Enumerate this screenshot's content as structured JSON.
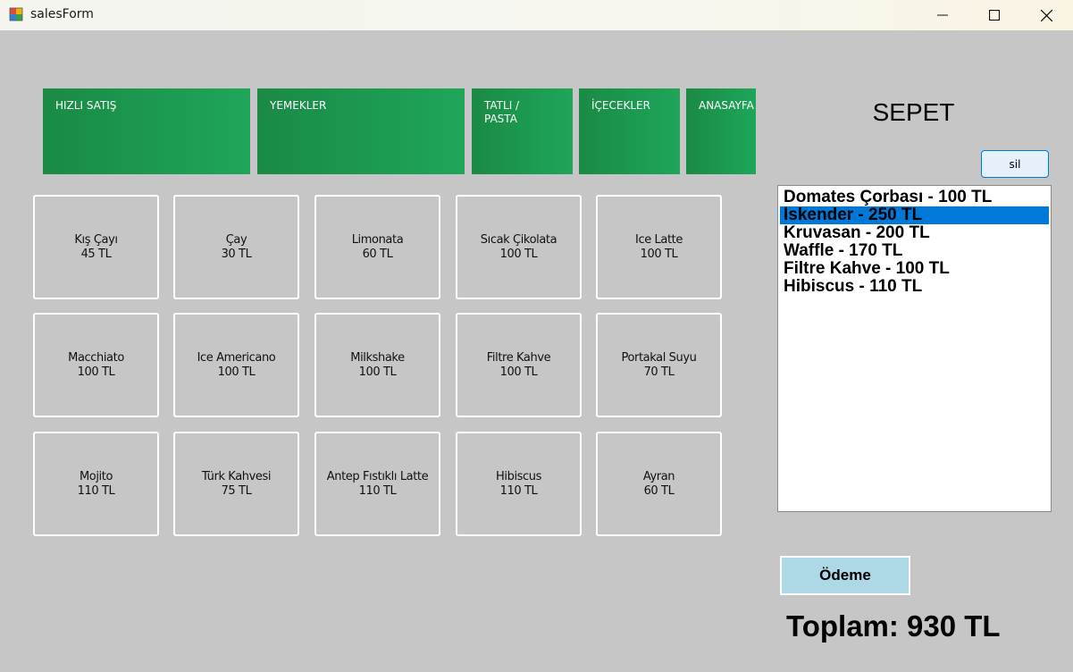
{
  "window": {
    "title": "salesForm",
    "app_icon": "windows-forms-icon",
    "controls": [
      "minimize-icon",
      "maximize-icon",
      "close-icon"
    ]
  },
  "categories": [
    {
      "label": "HIZLI SATIŞ"
    },
    {
      "label": "YEMEKLER"
    },
    {
      "label": "TATLI /\nPASTA"
    },
    {
      "label": "İÇECEKLER"
    },
    {
      "label": "ANASAYFA"
    }
  ],
  "products": [
    {
      "name": "Kış Çayı",
      "price": "45 TL"
    },
    {
      "name": "Çay",
      "price": "30 TL"
    },
    {
      "name": "Limonata",
      "price": "60 TL"
    },
    {
      "name": "Sıcak Çikolata",
      "price": "100 TL"
    },
    {
      "name": "Ice Latte",
      "price": "100 TL"
    },
    {
      "name": "Macchiato",
      "price": "100 TL"
    },
    {
      "name": "Ice Americano",
      "price": "100 TL"
    },
    {
      "name": "Milkshake",
      "price": "100 TL"
    },
    {
      "name": "Filtre Kahve",
      "price": "100 TL"
    },
    {
      "name": "Portakal Suyu",
      "price": "70 TL"
    },
    {
      "name": "Mojito",
      "price": "110 TL"
    },
    {
      "name": "Türk Kahvesi",
      "price": "75 TL"
    },
    {
      "name": "Antep Fıstıklı Latte",
      "price": "110 TL"
    },
    {
      "name": "Hibiscus",
      "price": "110 TL"
    },
    {
      "name": "Ayran",
      "price": "60 TL"
    }
  ],
  "cart": {
    "title": "SEPET",
    "delete_label": "sil",
    "selected_index": 1,
    "items": [
      "Domates Çorbası - 100 TL",
      "İskender - 250 TL",
      "Kruvasan - 200 TL",
      "Waffle - 170 TL",
      "Filtre Kahve - 100 TL",
      "Hibiscus - 110 TL"
    ]
  },
  "payment": {
    "button_label": "Ödeme",
    "total_label": "Toplam: 930 TL"
  },
  "colors": {
    "form_background": "#c6c6c6",
    "category_green": "#1ea65a",
    "selection_blue": "#0078d7",
    "payment_button": "#add8e6"
  }
}
